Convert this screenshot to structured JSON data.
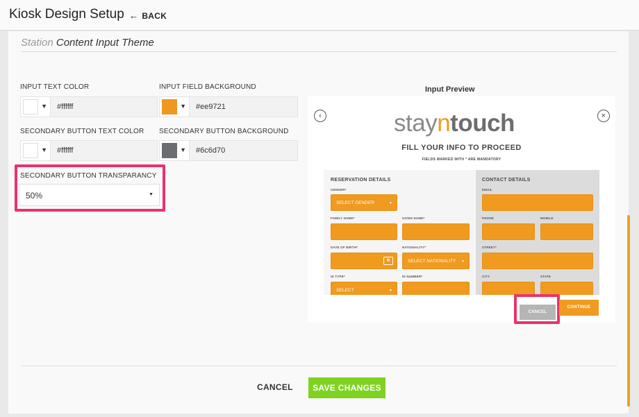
{
  "header": {
    "title": "Kiosk Design Setup",
    "back_label": "BACK",
    "back_icon": "arrow-left-icon"
  },
  "section": {
    "title_prefix": "Station",
    "title_main": "Content Input Theme"
  },
  "fields": {
    "input_text_color": {
      "label": "INPUT TEXT COLOR",
      "value": "#ffffff",
      "swatch": "#ffffff"
    },
    "input_field_background": {
      "label": "INPUT FIELD BACKGROUND",
      "value": "#ee9721",
      "swatch": "#ee9721"
    },
    "secondary_button_text_color": {
      "label": "SECONDARY BUTTON TEXT COLOR",
      "value": "#ffffff",
      "swatch": "#ffffff"
    },
    "secondary_button_background": {
      "label": "SECONDARY BUTTON BACKGROUND",
      "value": "#6c6d70",
      "swatch": "#6c6d70"
    },
    "secondary_button_transparency": {
      "label": "SECONDARY BUTTON TRANSPARANCY",
      "value": "50%"
    }
  },
  "preview": {
    "title": "Input Preview",
    "logo_part1": "stay",
    "logo_part2": "n",
    "logo_part3": "touch",
    "heading": "FILL YOUR INFO TO PROCEED",
    "mandatory_note": "FIELDS MARKED WITH * ARE MANDATORY",
    "reservation_head": "RESERVATION DETAILS",
    "contact_head": "CONTACT DETAILS",
    "labels": {
      "gender": "GENDER*",
      "family_name": "FAMILY NAME*",
      "given_name": "GIVEN NAME*",
      "date_of_birth": "DATE OF BIRTH*",
      "nationality": "NATIONALITY*",
      "id_type": "ID TYPE*",
      "id_number": "ID NUMBER*",
      "email": "EMAIL",
      "phone": "PHONE",
      "mobile": "MOBILE",
      "street": "STREET*",
      "city": "CITY",
      "state": "STATE"
    },
    "select_gender": "SELECT GENDER",
    "select_nationality": "SELECT NATIONALITY",
    "select_id": "SELECT",
    "cancel_label": "CANCEL",
    "continue_label": "CONTINUE"
  },
  "footer": {
    "cancel_label": "CANCEL",
    "save_label": "SAVE CHANGES"
  },
  "colors": {
    "accent_orange": "#f09a1f",
    "save_green": "#7ed321",
    "highlight_pink": "#e8336b"
  }
}
